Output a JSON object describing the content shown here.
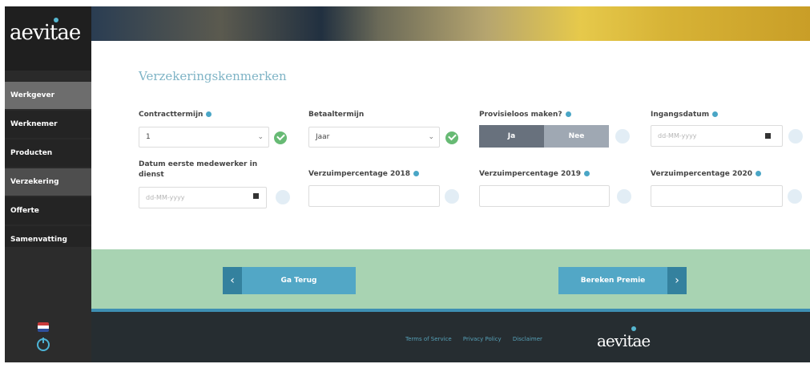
{
  "brand": {
    "logo_text": "aevitae",
    "accent": "#4aa6c6"
  },
  "sidebar": {
    "items": [
      {
        "label": "Werkgever",
        "state": "active"
      },
      {
        "label": "Werknemer",
        "state": "normal"
      },
      {
        "label": "Producten",
        "state": "normal"
      },
      {
        "label": "Verzekering",
        "state": "muted"
      },
      {
        "label": "Offerte",
        "state": "normal"
      },
      {
        "label": "Samenvatting",
        "state": "normal"
      }
    ],
    "icons": [
      "netherlands-flag-icon",
      "power-icon"
    ]
  },
  "form": {
    "title": "Verzekeringskenmerken",
    "contracttermijn": {
      "label": "Contracttermijn",
      "value": "1"
    },
    "betaaltermijn": {
      "label": "Betaaltermijn",
      "value": "Jaar"
    },
    "provisieloos": {
      "label": "Provisieloos maken?",
      "yes": "Ja",
      "no": "Nee"
    },
    "ingangsdatum": {
      "label": "Ingangsdatum",
      "placeholder": "dd-MM-yyyy"
    },
    "datum_eerste": {
      "label": "Datum eerste medewerker in dienst",
      "placeholder": "dd-MM-yyyy"
    },
    "verzuim_2018": {
      "label": "Verzuimpercentage 2018",
      "value": ""
    },
    "verzuim_2019": {
      "label": "Verzuimpercentage 2019",
      "value": ""
    },
    "verzuim_2020": {
      "label": "Verzuimpercentage 2020",
      "value": ""
    }
  },
  "actions": {
    "back": "Ga Terug",
    "next": "Bereken Premie"
  },
  "footer": {
    "links": [
      "Terms of Service",
      "Privacy Policy",
      "Disclaimer"
    ],
    "logo_text": "aevitae"
  }
}
